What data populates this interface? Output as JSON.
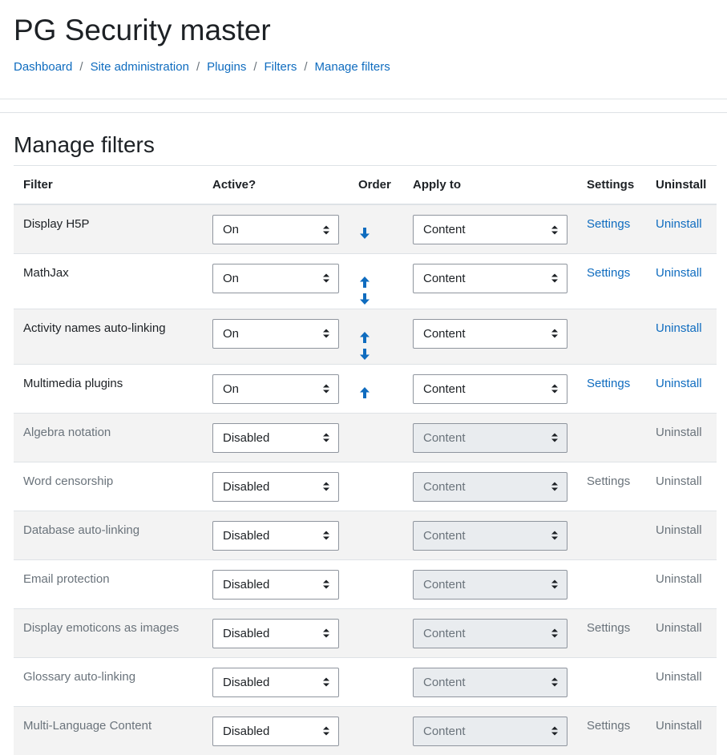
{
  "site": {
    "title": "PG Security master"
  },
  "breadcrumb": [
    "Dashboard",
    "Site administration",
    "Plugins",
    "Filters",
    "Manage filters"
  ],
  "page": {
    "heading": "Manage filters"
  },
  "table": {
    "headers": {
      "filter": "Filter",
      "active": "Active?",
      "order": "Order",
      "apply_to": "Apply to",
      "settings": "Settings",
      "uninstall": "Uninstall"
    },
    "rows": [
      {
        "name": "Display H5P",
        "active": "On",
        "apply_to": "Content",
        "settings": "Settings",
        "uninstall": "Uninstall",
        "up": false,
        "down": true
      },
      {
        "name": "MathJax",
        "active": "On",
        "apply_to": "Content",
        "settings": "Settings",
        "uninstall": "Uninstall",
        "up": true,
        "down": true
      },
      {
        "name": "Activity names auto-linking",
        "active": "On",
        "apply_to": "Content",
        "settings": "",
        "uninstall": "Uninstall",
        "up": true,
        "down": true
      },
      {
        "name": "Multimedia plugins",
        "active": "On",
        "apply_to": "Content",
        "settings": "Settings",
        "uninstall": "Uninstall",
        "up": true,
        "down": false
      },
      {
        "name": "Algebra notation",
        "active": "Disabled",
        "apply_to": "Content",
        "settings": "",
        "uninstall": "Uninstall",
        "up": false,
        "down": false
      },
      {
        "name": "Word censorship",
        "active": "Disabled",
        "apply_to": "Content",
        "settings": "Settings",
        "uninstall": "Uninstall",
        "up": false,
        "down": false
      },
      {
        "name": "Database auto-linking",
        "active": "Disabled",
        "apply_to": "Content",
        "settings": "",
        "uninstall": "Uninstall",
        "up": false,
        "down": false
      },
      {
        "name": "Email protection",
        "active": "Disabled",
        "apply_to": "Content",
        "settings": "",
        "uninstall": "Uninstall",
        "up": false,
        "down": false
      },
      {
        "name": "Display emoticons as images",
        "active": "Disabled",
        "apply_to": "Content",
        "settings": "Settings",
        "uninstall": "Uninstall",
        "up": false,
        "down": false
      },
      {
        "name": "Glossary auto-linking",
        "active": "Disabled",
        "apply_to": "Content",
        "settings": "",
        "uninstall": "Uninstall",
        "up": false,
        "down": false
      },
      {
        "name": "Multi-Language Content",
        "active": "Disabled",
        "apply_to": "Content",
        "settings": "Settings",
        "uninstall": "Uninstall",
        "up": false,
        "down": false
      }
    ]
  },
  "icons": {
    "up": "arrow-up-icon",
    "down": "arrow-down-icon",
    "caret": "select-caret-icon"
  },
  "colors": {
    "link": "#0f6cbf",
    "muted": "#6a737b",
    "text": "#1d2125",
    "stripe": "#f3f3f3",
    "disabled_select": "#e9ecef"
  }
}
